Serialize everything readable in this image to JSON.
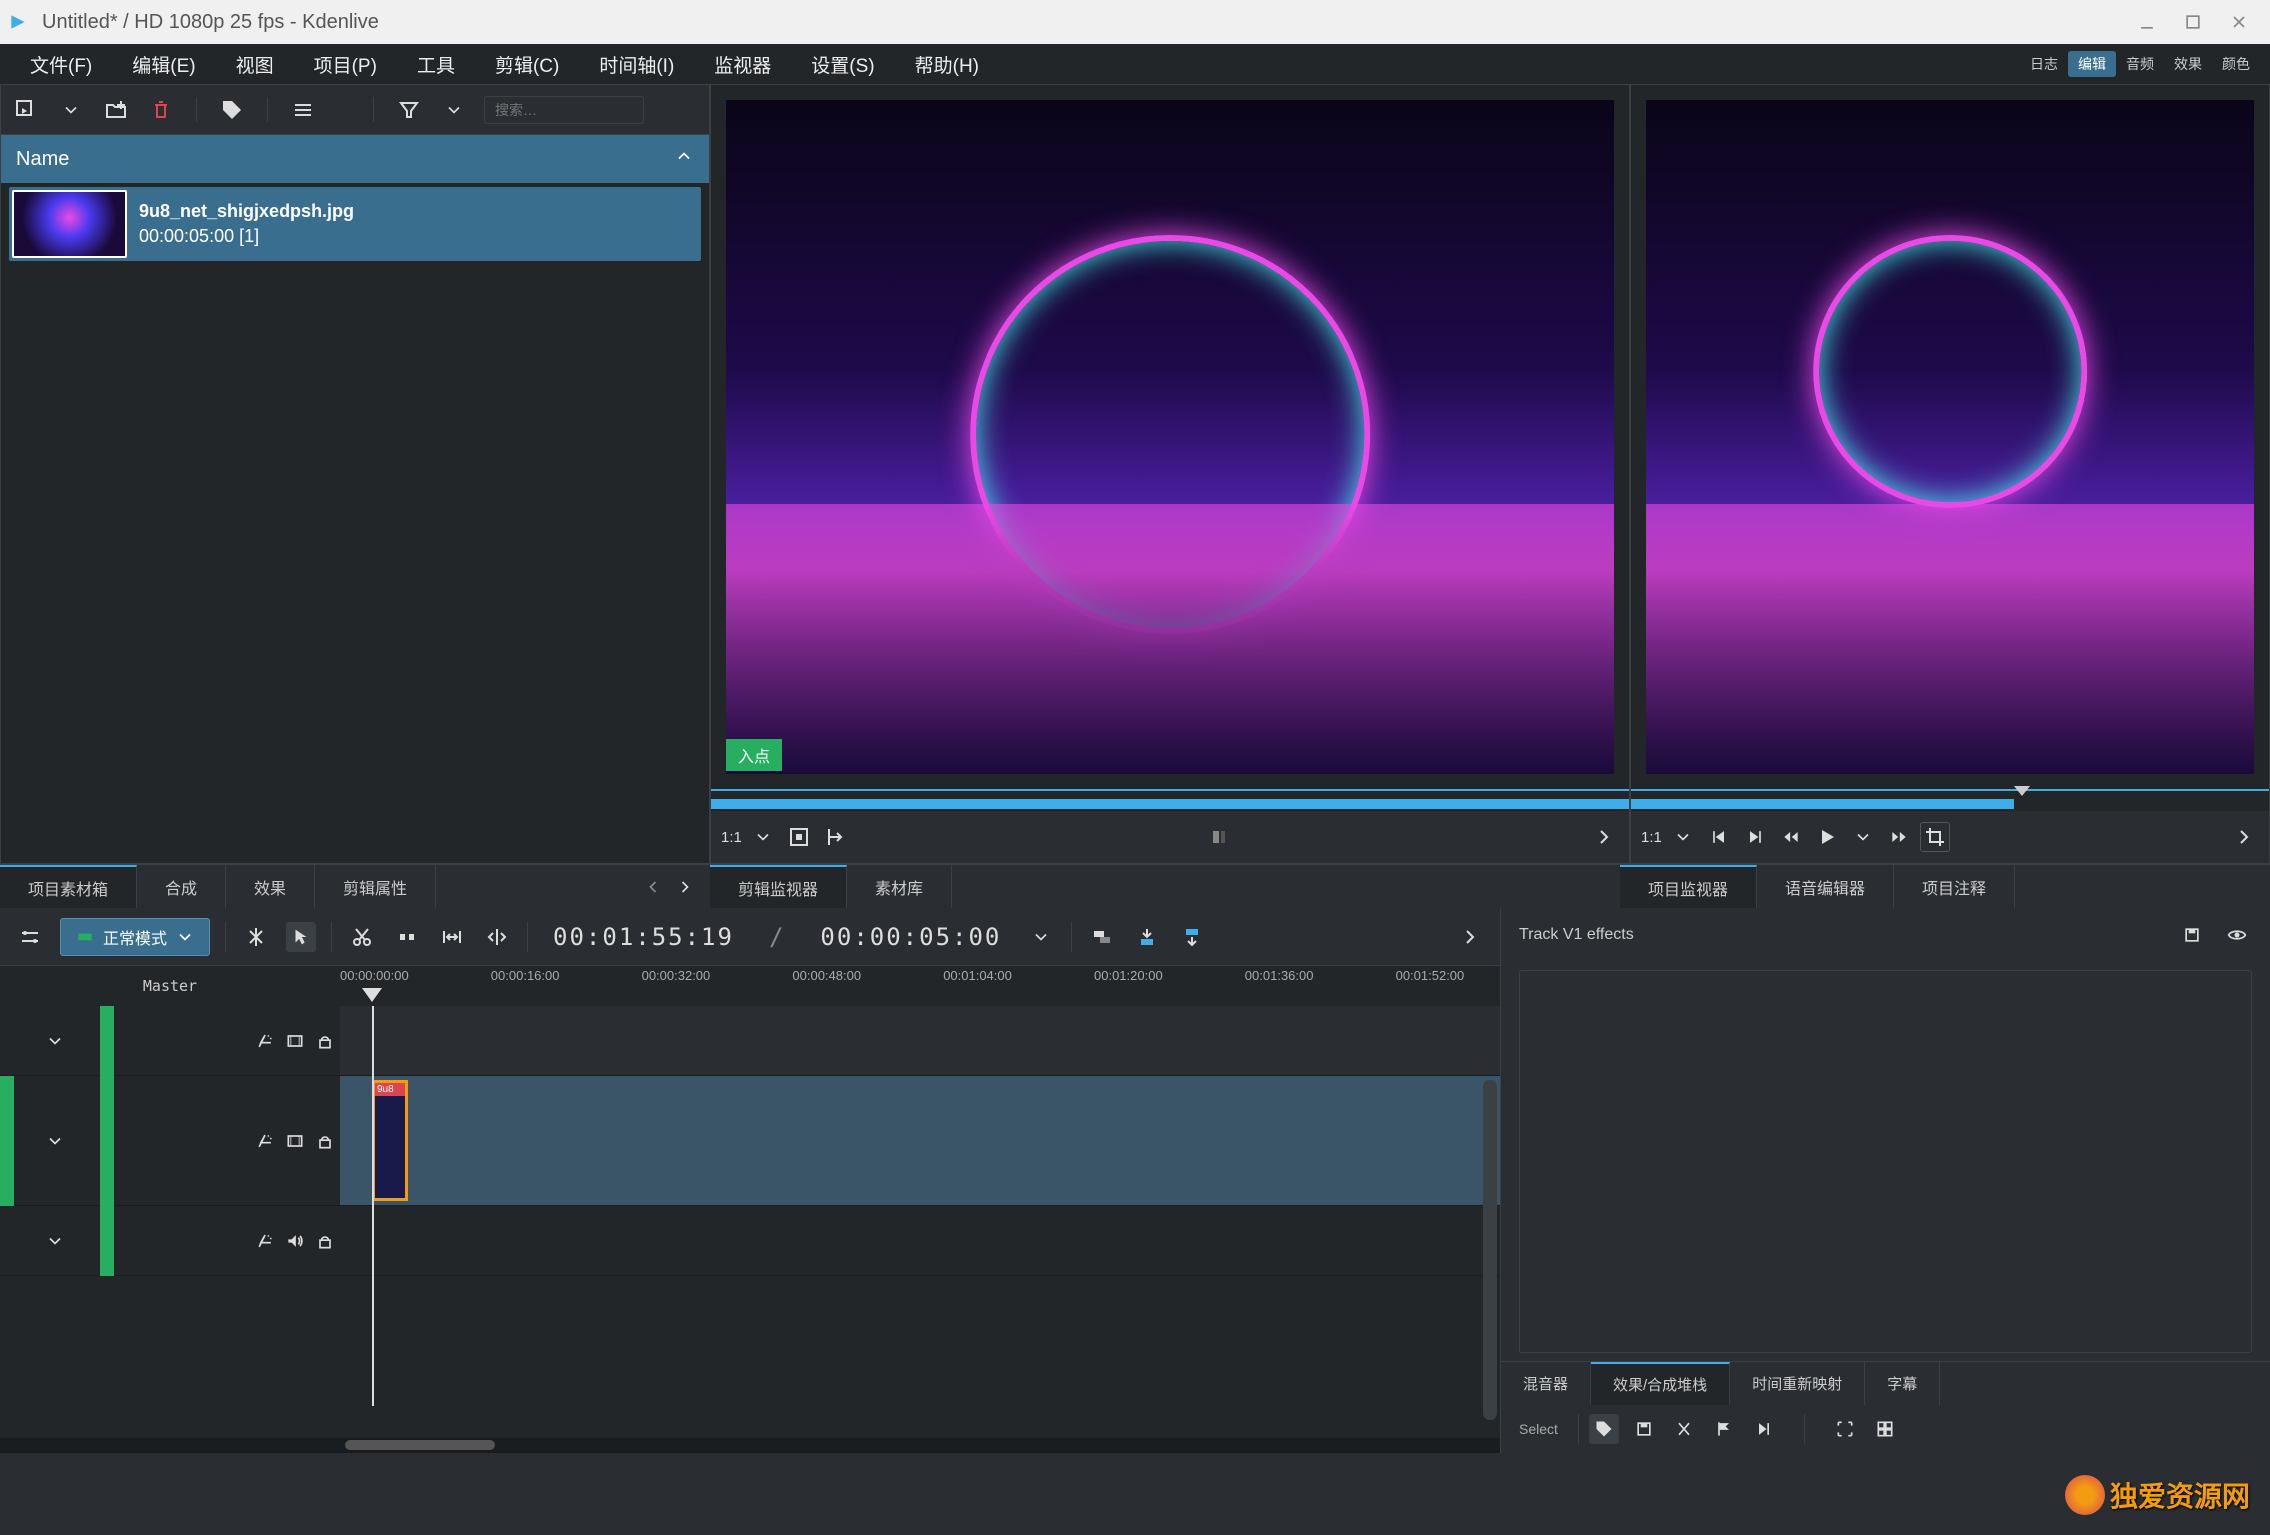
{
  "window": {
    "title": "Untitled* / HD 1080p 25 fps - Kdenlive"
  },
  "menu": {
    "items": [
      "文件(F)",
      "编辑(E)",
      "视图",
      "项目(P)",
      "工具",
      "剪辑(C)",
      "时间轴(I)",
      "监视器",
      "设置(S)",
      "帮助(H)"
    ],
    "right": [
      {
        "label": "日志",
        "active": false
      },
      {
        "label": "编辑",
        "active": true
      },
      {
        "label": "音频",
        "active": false
      },
      {
        "label": "效果",
        "active": false
      },
      {
        "label": "颜色",
        "active": false
      }
    ]
  },
  "bin": {
    "search_placeholder": "搜索…",
    "header": "Name",
    "items": [
      {
        "name": "9u8_net_shigjxedpsh.jpg",
        "meta": "00:00:05:00 [1]"
      }
    ]
  },
  "clip_monitor": {
    "in_label": "入点",
    "zoom": "1:1"
  },
  "project_monitor": {
    "zoom": "1:1"
  },
  "left_tabs": [
    "项目素材箱",
    "合成",
    "效果",
    "剪辑属性"
  ],
  "left_tabs_active": 0,
  "mid_tabs": [
    "剪辑监视器",
    "素材库"
  ],
  "mid_tabs_active": 0,
  "right_tabs": [
    "项目监视器",
    "语音编辑器",
    "项目注释"
  ],
  "right_tabs_active": 0,
  "timeline": {
    "mode_label": "正常模式",
    "timecode_pos": "00:01:55:19",
    "timecode_dur": "00:00:05:00",
    "master_label": "Master",
    "ruler": [
      "00:00:00:00",
      "00:00:16:00",
      "00:00:32:00",
      "00:00:48:00",
      "00:01:04:00",
      "00:01:20:00",
      "00:01:36:00",
      "00:01:52:00"
    ],
    "tracks": [
      {
        "id": "V2",
        "type": "video"
      },
      {
        "id": "V1",
        "type": "video",
        "clip": "9u8"
      },
      {
        "id": "A1",
        "type": "audio"
      }
    ]
  },
  "effects_panel": {
    "title": "Track V1 effects",
    "tabs": [
      "混音器",
      "效果/合成堆栈",
      "时间重新映射",
      "字幕"
    ],
    "tabs_active": 1,
    "footer_label": "Select"
  },
  "watermark": "独爱资源网"
}
